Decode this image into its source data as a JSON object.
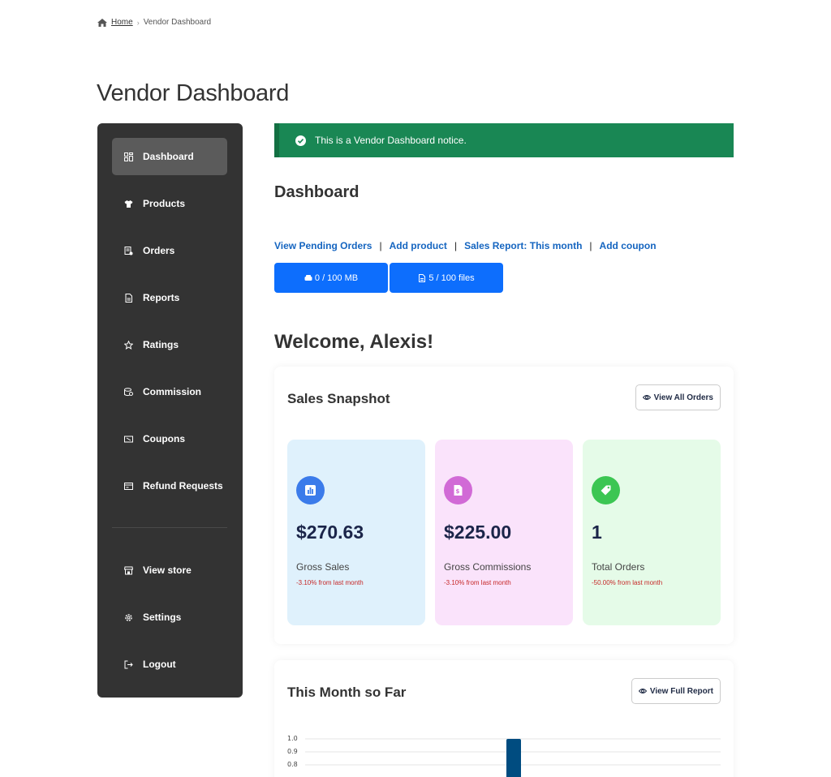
{
  "breadcrumb": {
    "home": "Home",
    "separator": "›",
    "current": "Vendor Dashboard"
  },
  "page_title": "Vendor Dashboard",
  "sidebar": {
    "items": [
      {
        "label": "Dashboard",
        "icon": "dashboard-icon",
        "active": true
      },
      {
        "label": "Products",
        "icon": "tshirt-icon",
        "active": false
      },
      {
        "label": "Orders",
        "icon": "orders-icon",
        "active": false
      },
      {
        "label": "Reports",
        "icon": "report-icon",
        "active": false
      },
      {
        "label": "Ratings",
        "icon": "star-icon",
        "active": false
      },
      {
        "label": "Commission",
        "icon": "commission-icon",
        "active": false
      },
      {
        "label": "Coupons",
        "icon": "coupon-icon",
        "active": false
      },
      {
        "label": "Refund Requests",
        "icon": "refund-icon",
        "active": false
      }
    ],
    "secondary_items": [
      {
        "label": "View store",
        "icon": "store-icon"
      },
      {
        "label": "Settings",
        "icon": "gear-icon"
      },
      {
        "label": "Logout",
        "icon": "logout-icon"
      }
    ]
  },
  "notice": {
    "text": "This is a Vendor Dashboard notice.",
    "color": "#198754"
  },
  "dashboard": {
    "title": "Dashboard",
    "links": [
      "View Pending Orders",
      "Add product",
      "Sales Report: This month",
      "Add coupon"
    ],
    "link_separator": "|",
    "storage": "0 / 100 MB",
    "files": "5 / 100 files"
  },
  "welcome": "Welcome, Alexis!",
  "sales_snapshot": {
    "title": "Sales Snapshot",
    "button": "View All Orders",
    "stats": [
      {
        "value": "$270.63",
        "label": "Gross Sales",
        "change": "-3.10% from last month",
        "bg": "#dff1fc",
        "icon_bg": "#3b7bea",
        "icon": "bar-chart-icon"
      },
      {
        "value": "$225.00",
        "label": "Gross Commissions",
        "change": "-3.10% from last month",
        "bg": "#fae3fb",
        "icon_bg": "#d16ad6",
        "icon": "document-icon"
      },
      {
        "value": "1",
        "label": "Total Orders",
        "change": "-50.00% from last month",
        "bg": "#e5fbe8",
        "icon_bg": "#3cc653",
        "icon": "tag-icon"
      }
    ]
  },
  "month_report": {
    "title": "This Month so Far",
    "button": "View Full Report"
  },
  "chart_data": {
    "type": "bar",
    "title": "",
    "y_ticks": [
      "1.0",
      "0.9",
      "0.8"
    ],
    "ylim_visible": [
      0.8,
      1.0
    ],
    "bar_color": "#004c80",
    "values": [
      1
    ]
  }
}
